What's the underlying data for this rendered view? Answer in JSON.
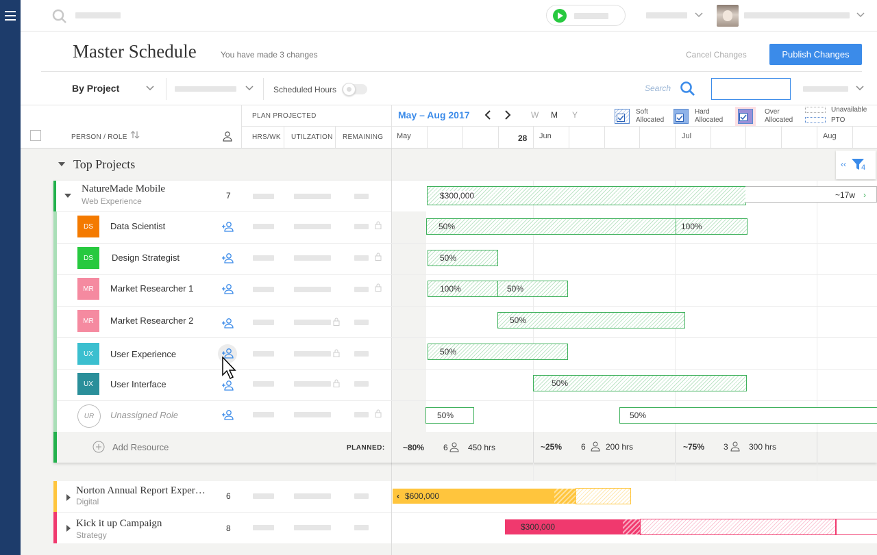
{
  "page": {
    "title": "Master Schedule",
    "changes_note": "You have made 3 changes",
    "cancel_label": "Cancel Changes",
    "publish_label": "Publish Changes"
  },
  "toolbar": {
    "view_select": "By Project",
    "scheduled_hours_label": "Scheduled Hours",
    "scheduled_hours_on": false,
    "search_label": "Search",
    "search_value": ""
  },
  "columns": {
    "person_role": "PERSON / ROLE",
    "plan_projected": "PLAN PROJECTED",
    "hrs_wk": "HRS/WK",
    "utilization": "UTILZATION",
    "remaining": "REMAINING"
  },
  "timeline": {
    "range": "May – Aug 2017",
    "zoom_w": "W",
    "zoom_m": "M",
    "zoom_y": "Y",
    "months": [
      "May",
      "Jun",
      "Jul",
      "Aug"
    ],
    "today": "28"
  },
  "legend": {
    "soft": [
      "Soft",
      "Allocated"
    ],
    "hard": [
      "Hard",
      "Allocated"
    ],
    "over": [
      "Over",
      "Allocated"
    ],
    "unavailable": "Unavailable",
    "pto": "PTO"
  },
  "group": {
    "title": "Top Projects",
    "filter_count": "4"
  },
  "project": {
    "name": "NatureMade Mobile",
    "type": "Web Experience",
    "count": "7",
    "budget": "$300,000",
    "duration": "~17w"
  },
  "roles": [
    {
      "initials": "DS",
      "name": "Data Scientist",
      "color": "#f47a00",
      "bars": [
        "50%",
        "100%"
      ]
    },
    {
      "initials": "DS",
      "name": "Design Strategist",
      "color": "#27c93f",
      "bars": [
        "50%"
      ]
    },
    {
      "initials": "MR",
      "name": "Market Researcher 1",
      "color": "#f58aa0",
      "bars": [
        "100%",
        "50%"
      ]
    },
    {
      "initials": "MR",
      "name": "Market Researcher 2",
      "color": "#f58aa0",
      "bars": [
        "50%"
      ]
    },
    {
      "initials": "UX",
      "name": "User Experience",
      "color": "#3bbfcf",
      "bars": [
        "50%"
      ]
    },
    {
      "initials": "UX",
      "name": "User Interface",
      "color": "#2a8f9a",
      "bars": [
        "50%"
      ]
    },
    {
      "initials": "UR",
      "name": "Unassigned Role",
      "color": "#ffffff",
      "bars": [
        "50%",
        "50%"
      ]
    }
  ],
  "planned": {
    "add_resource": "Add Resource",
    "label": "PLANNED:",
    "periods": [
      {
        "pct": "~80%",
        "people": "6",
        "hours": "450 hrs"
      },
      {
        "pct": "~25%",
        "people": "6",
        "hours": "200 hrs"
      },
      {
        "pct": "~75%",
        "people": "3",
        "hours": "300 hrs"
      }
    ]
  },
  "other_projects": [
    {
      "name": "Norton Annual Report Exper…",
      "type": "Digital",
      "count": "6",
      "budget": "$600,000",
      "color": "#ffc53d"
    },
    {
      "name": "Kick it up Campaign",
      "type": "Strategy",
      "count": "8",
      "budget": "$300,000",
      "color": "#f0396e"
    }
  ]
}
